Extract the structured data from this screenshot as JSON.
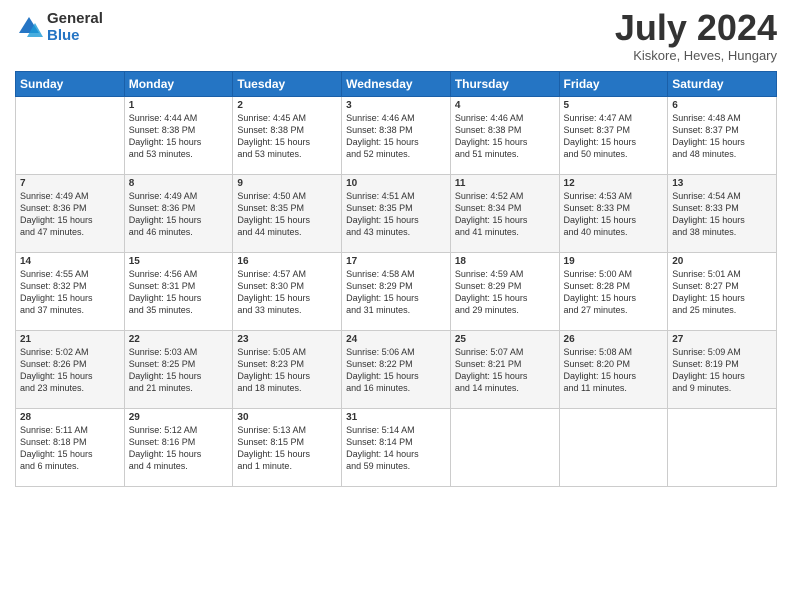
{
  "header": {
    "logo_line1": "General",
    "logo_line2": "Blue",
    "month_year": "July 2024",
    "location": "Kiskore, Heves, Hungary"
  },
  "weekdays": [
    "Sunday",
    "Monday",
    "Tuesday",
    "Wednesday",
    "Thursday",
    "Friday",
    "Saturday"
  ],
  "weeks": [
    [
      {
        "day": "",
        "text": ""
      },
      {
        "day": "1",
        "text": "Sunrise: 4:44 AM\nSunset: 8:38 PM\nDaylight: 15 hours\nand 53 minutes."
      },
      {
        "day": "2",
        "text": "Sunrise: 4:45 AM\nSunset: 8:38 PM\nDaylight: 15 hours\nand 53 minutes."
      },
      {
        "day": "3",
        "text": "Sunrise: 4:46 AM\nSunset: 8:38 PM\nDaylight: 15 hours\nand 52 minutes."
      },
      {
        "day": "4",
        "text": "Sunrise: 4:46 AM\nSunset: 8:38 PM\nDaylight: 15 hours\nand 51 minutes."
      },
      {
        "day": "5",
        "text": "Sunrise: 4:47 AM\nSunset: 8:37 PM\nDaylight: 15 hours\nand 50 minutes."
      },
      {
        "day": "6",
        "text": "Sunrise: 4:48 AM\nSunset: 8:37 PM\nDaylight: 15 hours\nand 48 minutes."
      }
    ],
    [
      {
        "day": "7",
        "text": "Sunrise: 4:49 AM\nSunset: 8:36 PM\nDaylight: 15 hours\nand 47 minutes."
      },
      {
        "day": "8",
        "text": "Sunrise: 4:49 AM\nSunset: 8:36 PM\nDaylight: 15 hours\nand 46 minutes."
      },
      {
        "day": "9",
        "text": "Sunrise: 4:50 AM\nSunset: 8:35 PM\nDaylight: 15 hours\nand 44 minutes."
      },
      {
        "day": "10",
        "text": "Sunrise: 4:51 AM\nSunset: 8:35 PM\nDaylight: 15 hours\nand 43 minutes."
      },
      {
        "day": "11",
        "text": "Sunrise: 4:52 AM\nSunset: 8:34 PM\nDaylight: 15 hours\nand 41 minutes."
      },
      {
        "day": "12",
        "text": "Sunrise: 4:53 AM\nSunset: 8:33 PM\nDaylight: 15 hours\nand 40 minutes."
      },
      {
        "day": "13",
        "text": "Sunrise: 4:54 AM\nSunset: 8:33 PM\nDaylight: 15 hours\nand 38 minutes."
      }
    ],
    [
      {
        "day": "14",
        "text": "Sunrise: 4:55 AM\nSunset: 8:32 PM\nDaylight: 15 hours\nand 37 minutes."
      },
      {
        "day": "15",
        "text": "Sunrise: 4:56 AM\nSunset: 8:31 PM\nDaylight: 15 hours\nand 35 minutes."
      },
      {
        "day": "16",
        "text": "Sunrise: 4:57 AM\nSunset: 8:30 PM\nDaylight: 15 hours\nand 33 minutes."
      },
      {
        "day": "17",
        "text": "Sunrise: 4:58 AM\nSunset: 8:29 PM\nDaylight: 15 hours\nand 31 minutes."
      },
      {
        "day": "18",
        "text": "Sunrise: 4:59 AM\nSunset: 8:29 PM\nDaylight: 15 hours\nand 29 minutes."
      },
      {
        "day": "19",
        "text": "Sunrise: 5:00 AM\nSunset: 8:28 PM\nDaylight: 15 hours\nand 27 minutes."
      },
      {
        "day": "20",
        "text": "Sunrise: 5:01 AM\nSunset: 8:27 PM\nDaylight: 15 hours\nand 25 minutes."
      }
    ],
    [
      {
        "day": "21",
        "text": "Sunrise: 5:02 AM\nSunset: 8:26 PM\nDaylight: 15 hours\nand 23 minutes."
      },
      {
        "day": "22",
        "text": "Sunrise: 5:03 AM\nSunset: 8:25 PM\nDaylight: 15 hours\nand 21 minutes."
      },
      {
        "day": "23",
        "text": "Sunrise: 5:05 AM\nSunset: 8:23 PM\nDaylight: 15 hours\nand 18 minutes."
      },
      {
        "day": "24",
        "text": "Sunrise: 5:06 AM\nSunset: 8:22 PM\nDaylight: 15 hours\nand 16 minutes."
      },
      {
        "day": "25",
        "text": "Sunrise: 5:07 AM\nSunset: 8:21 PM\nDaylight: 15 hours\nand 14 minutes."
      },
      {
        "day": "26",
        "text": "Sunrise: 5:08 AM\nSunset: 8:20 PM\nDaylight: 15 hours\nand 11 minutes."
      },
      {
        "day": "27",
        "text": "Sunrise: 5:09 AM\nSunset: 8:19 PM\nDaylight: 15 hours\nand 9 minutes."
      }
    ],
    [
      {
        "day": "28",
        "text": "Sunrise: 5:11 AM\nSunset: 8:18 PM\nDaylight: 15 hours\nand 6 minutes."
      },
      {
        "day": "29",
        "text": "Sunrise: 5:12 AM\nSunset: 8:16 PM\nDaylight: 15 hours\nand 4 minutes."
      },
      {
        "day": "30",
        "text": "Sunrise: 5:13 AM\nSunset: 8:15 PM\nDaylight: 15 hours\nand 1 minute."
      },
      {
        "day": "31",
        "text": "Sunrise: 5:14 AM\nSunset: 8:14 PM\nDaylight: 14 hours\nand 59 minutes."
      },
      {
        "day": "",
        "text": ""
      },
      {
        "day": "",
        "text": ""
      },
      {
        "day": "",
        "text": ""
      }
    ]
  ]
}
